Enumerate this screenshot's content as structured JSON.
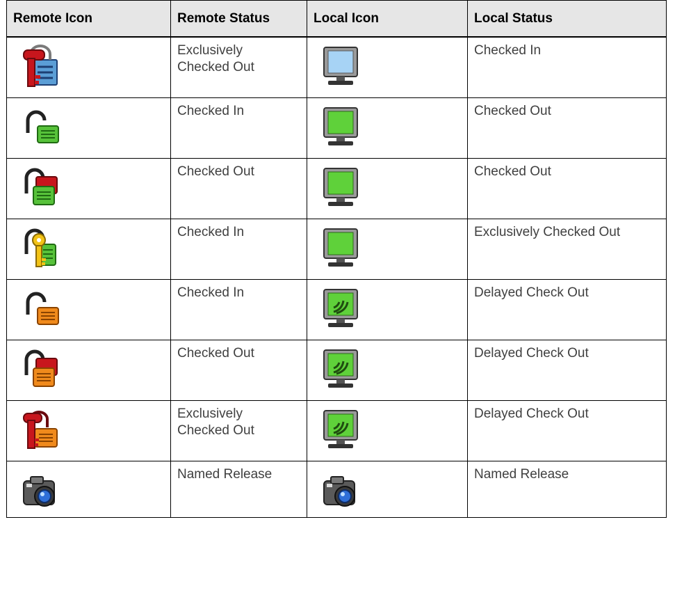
{
  "headers": {
    "remote_icon": "Remote Icon",
    "remote_status": "Remote Status",
    "local_icon": "Local Icon",
    "local_status": "Local Status"
  },
  "rows": [
    {
      "remote_icon": "locked-key-blue-icon",
      "remote_status": "Exclusively\nChecked Out",
      "local_icon": "monitor-blue-icon",
      "local_status": "Checked In"
    },
    {
      "remote_icon": "unlocked-green-icon",
      "remote_status": "Checked In",
      "local_icon": "monitor-green-icon",
      "local_status": "Checked Out"
    },
    {
      "remote_icon": "unlocked-red-green-icon",
      "remote_status": "Checked Out",
      "local_icon": "monitor-green-icon",
      "local_status": "Checked Out"
    },
    {
      "remote_icon": "unlocked-yellow-key-icon",
      "remote_status": "Checked In",
      "local_icon": "monitor-green-icon",
      "local_status": " Exclusively Checked Out"
    },
    {
      "remote_icon": "unlocked-orange-icon",
      "remote_status": "Checked In",
      "local_icon": "monitor-green-signal-icon",
      "local_status": " Delayed Check Out"
    },
    {
      "remote_icon": "unlocked-red-orange-icon",
      "remote_status": "Checked Out",
      "local_icon": "monitor-green-signal-icon",
      "local_status": "Delayed Check Out"
    },
    {
      "remote_icon": "locked-key-orange-icon",
      "remote_status": " Exclusively\nChecked Out",
      "local_icon": "monitor-green-signal-icon",
      "local_status": "Delayed Check Out"
    },
    {
      "remote_icon": "camera-icon",
      "remote_status": "Named Release",
      "local_icon": "camera-icon",
      "local_status": "Named Release"
    }
  ],
  "colors": {
    "header_bg": "#e6e6e6",
    "text": "#404040",
    "border": "#000000"
  }
}
